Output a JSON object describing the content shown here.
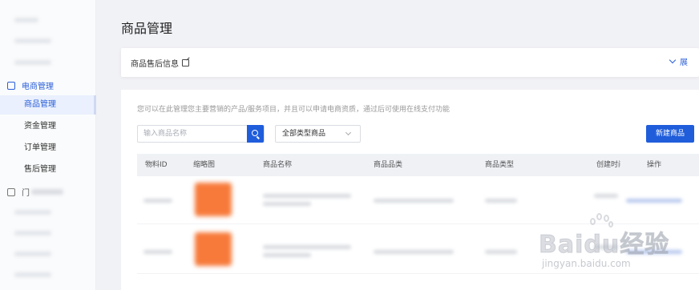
{
  "sidebar": {
    "section": "电商管理",
    "items": [
      {
        "label": "商品管理",
        "active": true
      },
      {
        "label": "资金管理",
        "active": false
      },
      {
        "label": "订单管理",
        "active": false
      },
      {
        "label": "售后管理",
        "active": false
      }
    ],
    "section2_prefix": "门"
  },
  "page": {
    "title": "商品管理"
  },
  "card": {
    "title": "商品售后信息",
    "toggle_label": "展"
  },
  "panel": {
    "description": "您可以在此管理您主要营销的产品/服务项目，并且可以申请电商资质，通过后可使用在线支付功能",
    "search_placeholder": "输入商品名称",
    "select_value": "全部类型商品",
    "new_button": "新建商品"
  },
  "table": {
    "headers": [
      "物料ID",
      "缩略图",
      "商品名称",
      "商品品类",
      "商品类型",
      "创建时间",
      "操作"
    ]
  },
  "watermark": {
    "main": "Baidu经验",
    "sub": "jingyan.baidu.com"
  },
  "colors": {
    "accent": "#1f5ddb",
    "thumb": "#f77a3a"
  }
}
